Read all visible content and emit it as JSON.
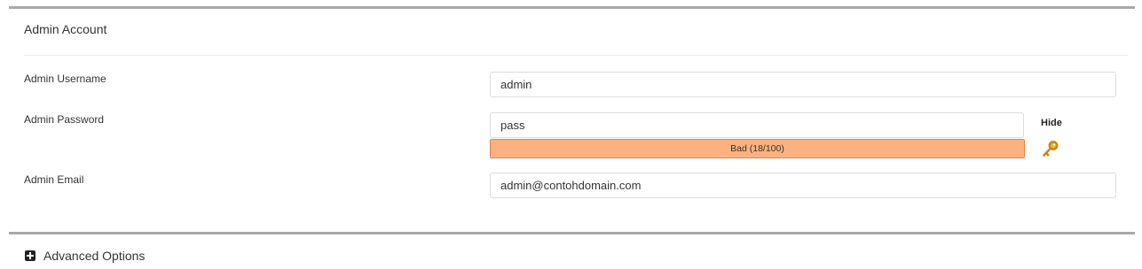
{
  "admin_account": {
    "title": "Admin Account",
    "username": {
      "label": "Admin Username",
      "value": "admin"
    },
    "password": {
      "label": "Admin Password",
      "value": "pass",
      "toggle_label": "Hide",
      "strength": {
        "text": "Bad (18/100)",
        "score_percent": 100,
        "color": "#fcb280"
      }
    },
    "email": {
      "label": "Admin Email",
      "value": "admin@contohdomain.com"
    }
  },
  "advanced": {
    "label": "Advanced Options"
  },
  "icons": {
    "generate_password": "key-icon",
    "expand": "plus-square-icon"
  }
}
